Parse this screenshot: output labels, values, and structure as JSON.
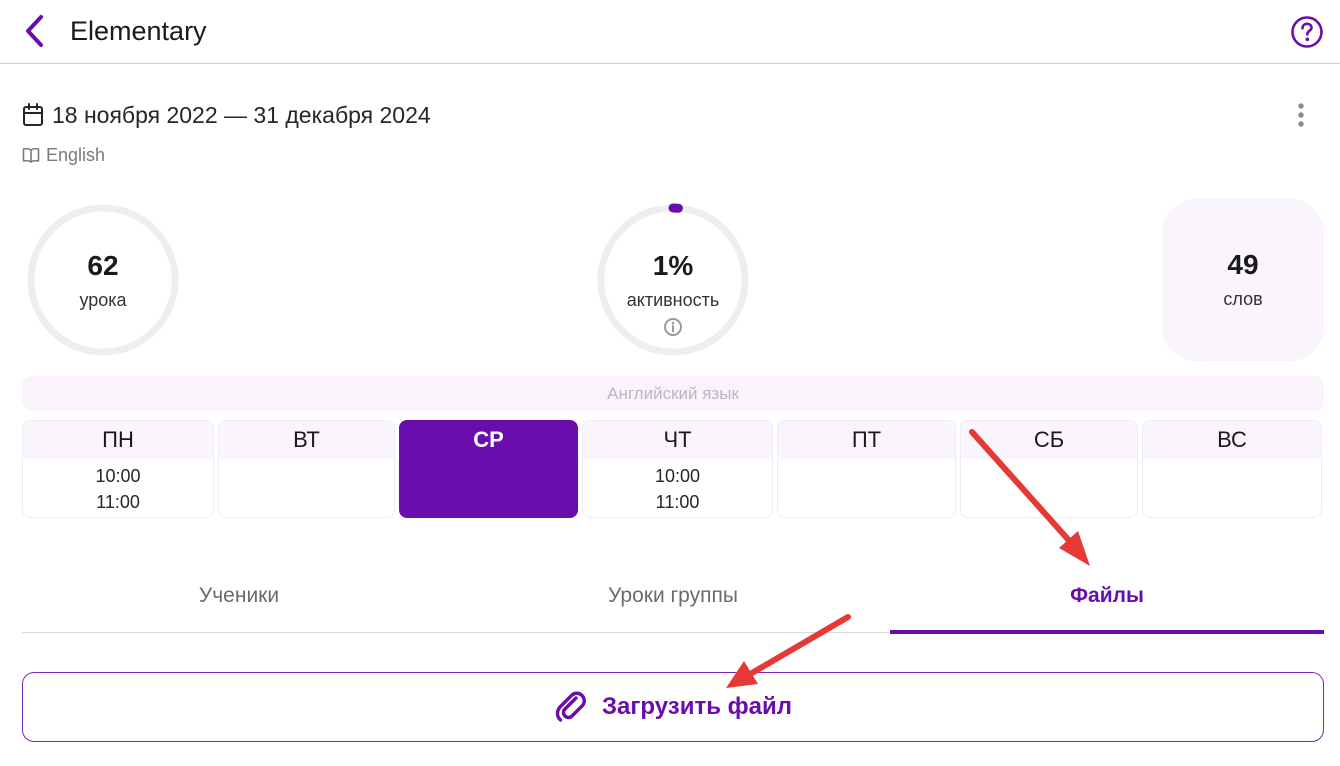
{
  "header": {
    "title": "Elementary"
  },
  "group": {
    "dates": "18 ноября 2022 — 31 декабря 2024",
    "language": "English"
  },
  "stats": {
    "lessons": {
      "value": "62",
      "label": "урока"
    },
    "activity": {
      "value": "1%",
      "label": "активность",
      "progress_percent": 1
    },
    "words": {
      "value": "49",
      "label": "слов"
    }
  },
  "subject": "Английский язык",
  "schedule": [
    {
      "day": "ПН",
      "times": [
        "10:00",
        "11:00"
      ],
      "active": false
    },
    {
      "day": "ВТ",
      "times": [],
      "active": false
    },
    {
      "day": "СР",
      "times": [],
      "active": true
    },
    {
      "day": "ЧТ",
      "times": [
        "10:00",
        "11:00"
      ],
      "active": false
    },
    {
      "day": "ПТ",
      "times": [],
      "active": false
    },
    {
      "day": "СБ",
      "times": [],
      "active": false
    },
    {
      "day": "ВС",
      "times": [],
      "active": false
    }
  ],
  "tabs": [
    {
      "label": "Ученики",
      "active": false
    },
    {
      "label": "Уроки группы",
      "active": false
    },
    {
      "label": "Файлы",
      "active": true
    }
  ],
  "upload": {
    "label": "Загрузить файл"
  },
  "icons": {
    "back": "chevron-left-icon",
    "help": "help-circle-icon",
    "more": "more-vertical-icon",
    "calendar": "calendar-icon",
    "book": "book-icon",
    "info": "info-icon",
    "upload": "paperclip-icon"
  },
  "colors": {
    "accent": "#6a0dad",
    "annotation_arrow": "#e53935",
    "ring_track": "#eeeeee"
  }
}
